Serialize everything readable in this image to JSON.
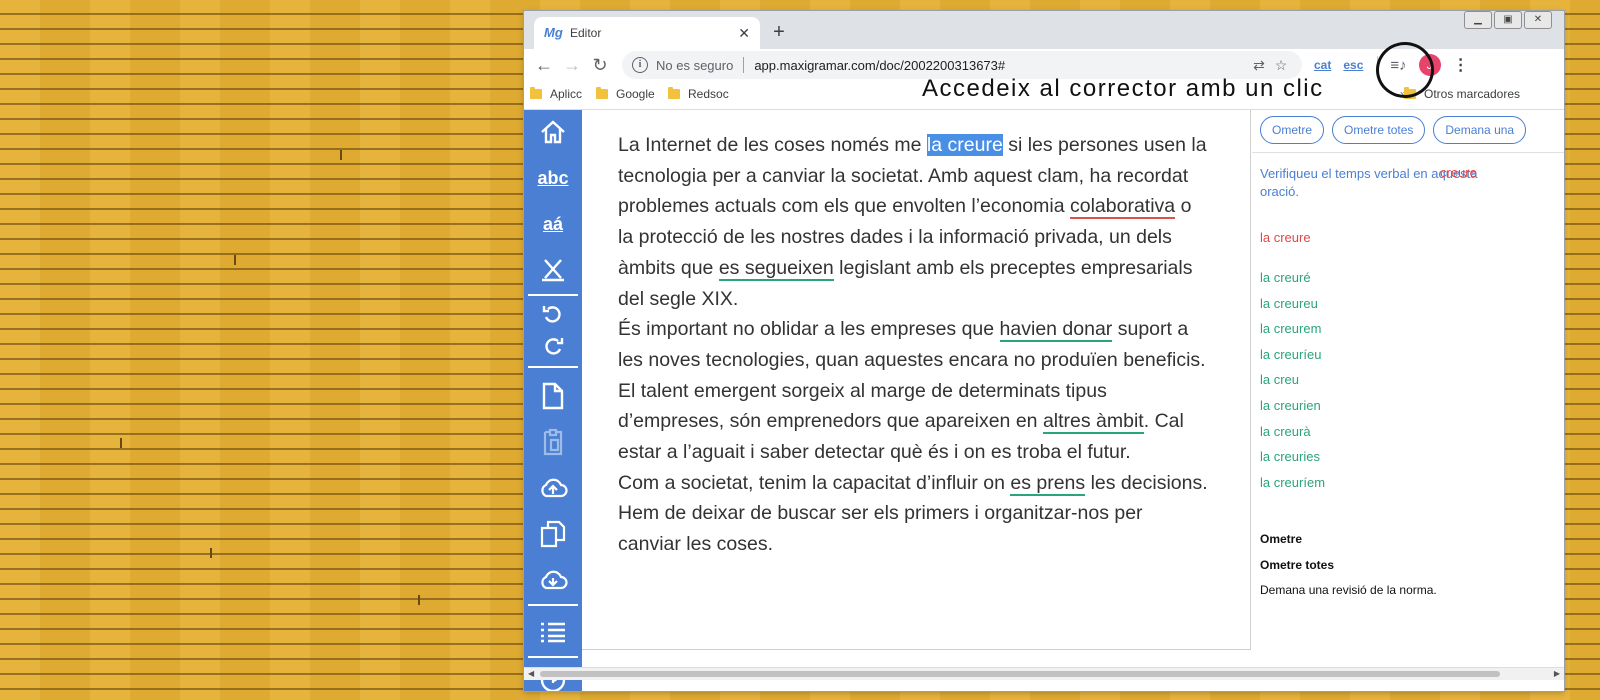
{
  "colors": {
    "accent": "#4a7fd4",
    "error_red": "#e04848",
    "suggestion_green": "#2aa57a",
    "highlight": "#4a8fe6",
    "wood": "#e5b033"
  },
  "browser": {
    "tab_title": "Editor",
    "tab_favicon": "maxigramar-logo-icon",
    "new_tab_label": "+",
    "window_controls": [
      "minimize-icon",
      "restore-icon",
      "close-icon"
    ],
    "security_label": "No es seguro",
    "url": "app.maxigramar.com/doc/2002200313673#",
    "extensions": {
      "cat_label": "cat",
      "esc_label": "esc"
    },
    "avatar_initial": "J"
  },
  "bookmarks": {
    "items": [
      {
        "label": "Aplicc"
      },
      {
        "label": "Google"
      },
      {
        "label": "Redsoc"
      }
    ],
    "chevron": "»",
    "other": "Otros marcadores"
  },
  "callout": {
    "text": "Accedeix al corrector amb un clic"
  },
  "sidebar": {
    "icons": [
      "home-icon",
      "spellcheck-icon",
      "accent-icon",
      "clear-format-icon",
      "undo-icon",
      "redo-icon",
      "new-document-icon",
      "paste-icon",
      "upload-cloud-icon",
      "copy-icon",
      "download-cloud-icon",
      "list-icon",
      "help-icon"
    ],
    "spell_label": "abc",
    "accent_label": "aá"
  },
  "editor": {
    "p1": {
      "t1": "La Internet de les coses només me ",
      "e1": "la creure",
      "t2": " si les persones usen la tecnologia per a canviar la societat. Amb aquest clam, ha recordat problemes actuals com els que envolten l’economia ",
      "e2": "colaborativa",
      "t3": " o la protecció de les nostres dades i la informació privada, un dels àmbits que ",
      "e3": "es segueixen",
      "t4": " legislant amb els preceptes empresarials del segle XIX."
    },
    "p2": {
      "t1": "És important no oblidar a les empreses que ",
      "e1": "havien donar",
      "t2": " suport a les noves tecnologies, quan aquestes encara no produïen beneficis."
    },
    "p3": {
      "t1": "El talent emergent sorgeix al marge de determinats tipus d’empreses, són emprenedors que apareixen en ",
      "e1": "altres àmbit",
      "t2": ". Cal estar a l’aguait i saber detectar què és i on es troba el futur."
    },
    "p4": {
      "t1": "Com a societat, tenim la capacitat d’influir on ",
      "e1": "es prens",
      "t2": " les decisions. Hem de deixar de buscar ser els primers i organitzar-nos per canviar les coses."
    }
  },
  "panel": {
    "buttons": [
      "Ometre",
      "Ometre totes",
      "Demana una"
    ],
    "message": "Verifiqueu el temps verbal en aquesta oració.",
    "message_word": "creure",
    "current": "la creure",
    "suggestions": [
      "la creuré",
      "la creureu",
      "la creurem",
      "la creuríeu",
      "la creu",
      "la creurien",
      "la creurà",
      "la creuries",
      "la creuríem"
    ],
    "actions": {
      "skip": "Ometre",
      "skip_all": "Ometre totes",
      "request": "Demana una revisió de la norma."
    }
  }
}
